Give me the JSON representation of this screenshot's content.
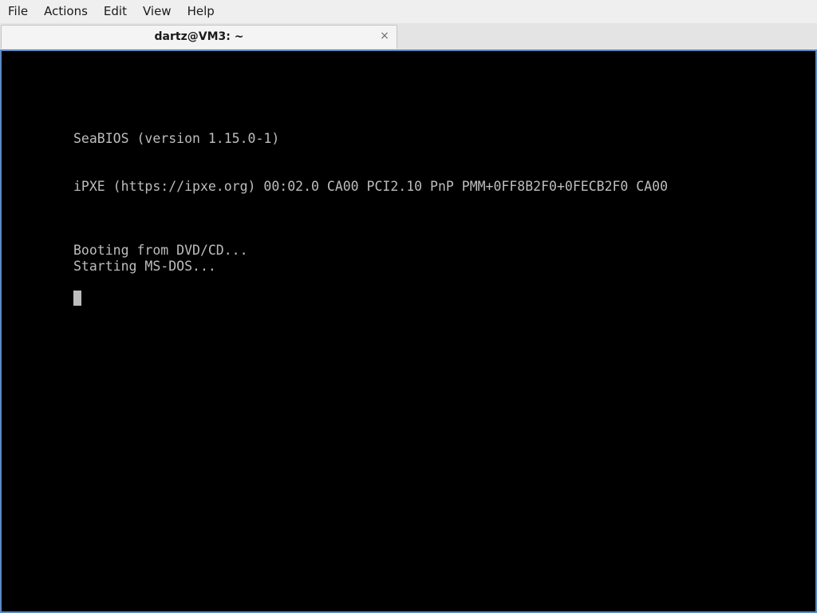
{
  "menubar": {
    "items": [
      "File",
      "Actions",
      "Edit",
      "View",
      "Help"
    ]
  },
  "tab": {
    "title": "dartz@VM3: ~",
    "close_glyph": "×"
  },
  "terminal": {
    "lines": [
      "SeaBIOS (version 1.15.0-1)",
      "iPXE (https://ipxe.org) 00:02.0 CA00 PCI2.10 PnP PMM+0FF8B2F0+0FECB2F0 CA00",
      "Booting from DVD/CD...",
      "Starting MS-DOS..."
    ]
  },
  "colors": {
    "terminal_bg": "#000000",
    "terminal_fg": "#bdbdbd",
    "focus_border": "#5b8ac4"
  }
}
